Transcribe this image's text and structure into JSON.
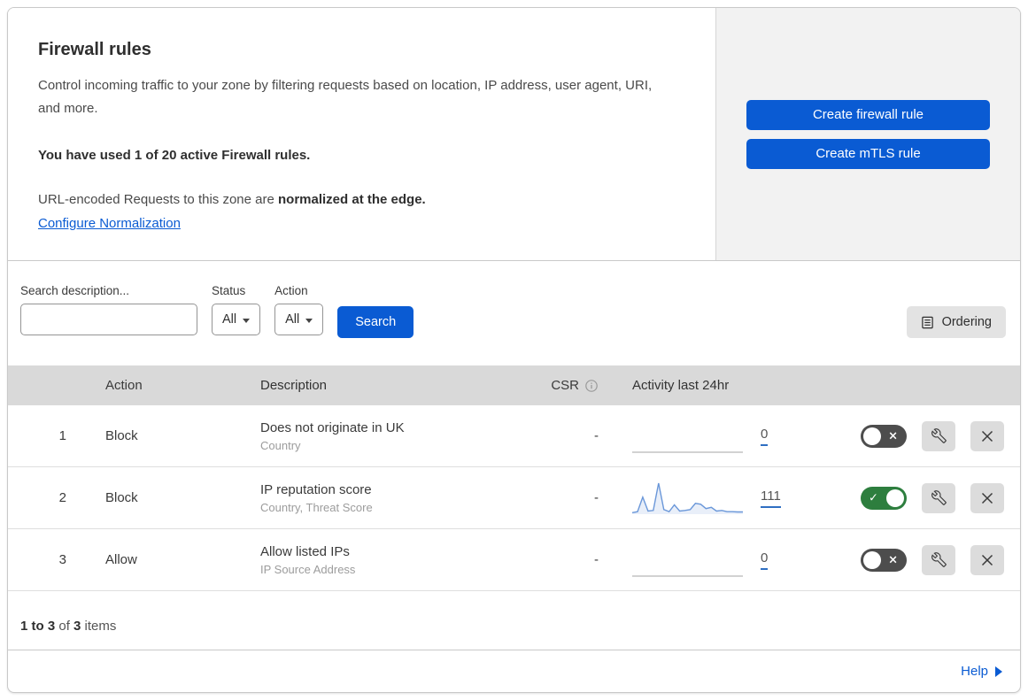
{
  "header": {
    "title": "Firewall rules",
    "description": "Control incoming traffic to your zone by filtering requests based on location, IP address, user agent, URI, and more.",
    "usage_notice": "You have used 1 of 20 active Firewall rules.",
    "normalization_prefix": "URL-encoded Requests to this zone are ",
    "normalization_bold": "normalized at the edge.",
    "normalization_link": "Configure Normalization",
    "create_firewall_button": "Create firewall rule",
    "create_mtls_button": "Create mTLS rule"
  },
  "filters": {
    "search_label": "Search description...",
    "status_label": "Status",
    "status_value": "All",
    "action_label": "Action",
    "action_value": "All",
    "search_button": "Search",
    "ordering_button": "Ordering"
  },
  "table": {
    "headers": {
      "action": "Action",
      "description": "Description",
      "csr": "CSR",
      "activity": "Activity last 24hr"
    },
    "rules": [
      {
        "priority": "1",
        "action": "Block",
        "description": "Does not originate in UK",
        "fields": "Country",
        "csr": "-",
        "activity_count": "0",
        "enabled": false,
        "spark_values": [
          0,
          0,
          0,
          0,
          0,
          0,
          0,
          0,
          0,
          0,
          0,
          0,
          0,
          0,
          0,
          0,
          0,
          0,
          0,
          0,
          0,
          0
        ]
      },
      {
        "priority": "2",
        "action": "Block",
        "description": "IP reputation score",
        "fields": "Country, Threat Score",
        "csr": "-",
        "activity_count": "111",
        "enabled": true,
        "spark_values": [
          5,
          8,
          55,
          10,
          12,
          100,
          15,
          8,
          30,
          10,
          12,
          15,
          35,
          32,
          18,
          22,
          10,
          12,
          8,
          8,
          7,
          7
        ]
      },
      {
        "priority": "3",
        "action": "Allow",
        "description": "Allow listed IPs",
        "fields": "IP Source Address",
        "csr": "-",
        "activity_count": "0",
        "enabled": false,
        "spark_values": [
          0,
          0,
          0,
          0,
          0,
          0,
          0,
          0,
          0,
          0,
          0,
          0,
          0,
          0,
          0,
          0,
          0,
          0,
          0,
          0,
          0,
          0
        ]
      }
    ]
  },
  "footer": {
    "range_bold": "1 to 3",
    "of_text": " of ",
    "total_bold": "3",
    "items_text": " items"
  },
  "help": {
    "label": "Help"
  },
  "icons": {
    "search": "search-icon",
    "info": "info-icon",
    "ordering": "list-document-icon",
    "wrench": "wrench-icon",
    "close": "close-icon"
  },
  "colors": {
    "accent_blue": "#0a5bd3",
    "toggle_on_green": "#2d7e3e",
    "toggle_off_gray": "#4d4d4d",
    "spark_line_blue": "#6a97d9",
    "spark_fill_blue": "#e9eff9",
    "spark_flat_gray": "#c4c4c4",
    "table_header_gray": "#d9d9d9"
  }
}
